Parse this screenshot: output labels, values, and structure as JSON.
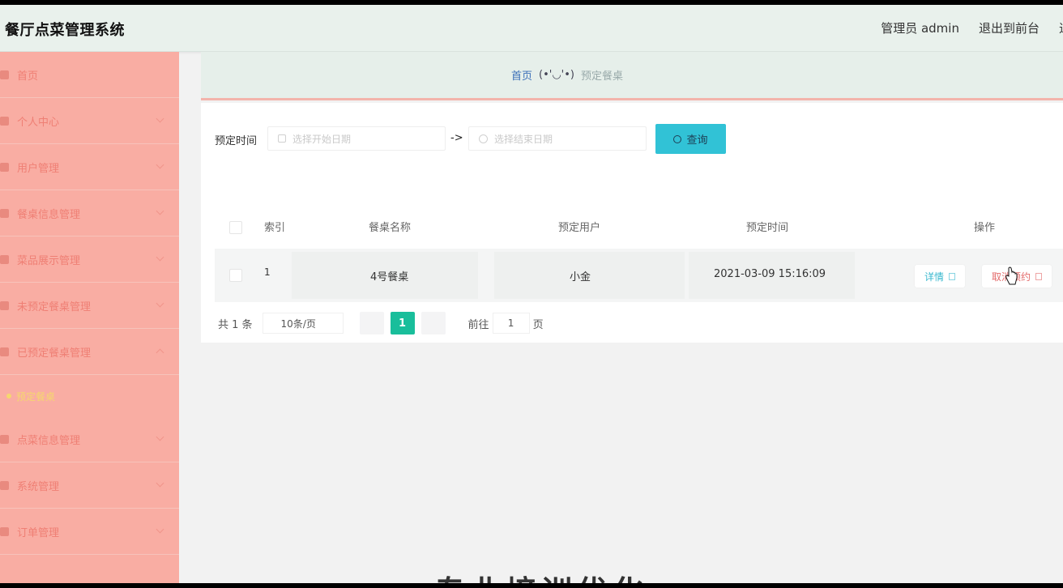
{
  "header": {
    "title": "餐厅点菜管理系统",
    "admin_label": "管理员 admin",
    "exit_front_label": "退出到前台",
    "exit_label": "退"
  },
  "sidebar": {
    "items": [
      {
        "label": "首页",
        "icon": "home-icon"
      },
      {
        "label": "个人中心",
        "icon": "user-icon"
      },
      {
        "label": "用户管理",
        "icon": "users-icon"
      },
      {
        "label": "餐桌信息管理",
        "icon": "table-icon"
      },
      {
        "label": "菜品展示管理",
        "icon": "dish-icon"
      },
      {
        "label": "未预定餐桌管理",
        "icon": "calendar-icon"
      },
      {
        "label": "已预定餐桌管理",
        "icon": "calendar-check-icon"
      },
      {
        "label": "点菜信息管理",
        "icon": "menu-icon"
      },
      {
        "label": "系统管理",
        "icon": "gear-icon"
      },
      {
        "label": "订单管理",
        "icon": "order-icon"
      }
    ],
    "active_sub": "预定餐桌",
    "colors": {
      "background": "#f9ada3",
      "text": "#ef7f74",
      "active": "#f5d76e"
    }
  },
  "breadcrumb": {
    "home": "首页",
    "separator": "(•'◡'•)",
    "current": "预定餐桌"
  },
  "search": {
    "label": "预定时间",
    "start_placeholder": "选择开始日期",
    "arrow": "->",
    "end_placeholder": "选择结束日期",
    "button_label": "查询"
  },
  "table": {
    "columns": [
      "索引",
      "餐桌名称",
      "预定用户",
      "预定时间",
      "操作"
    ],
    "rows": [
      {
        "index": "1",
        "table_name": "4号餐桌",
        "user": "小金",
        "time": "2021-03-09 15:16:09",
        "actions": [
          "详情",
          "取消预约"
        ]
      }
    ]
  },
  "pagination": {
    "total_text": "共 1 条",
    "page_size": "10条/页",
    "current_page": "1",
    "goto_label": "前往",
    "goto_value": "1",
    "page_unit": "页"
  },
  "watermark": "专业培训优化",
  "colors": {
    "accent": "#19be9b",
    "button": "#31c2d6",
    "header_bg": "#e9f1ec",
    "danger": "#e36a6a"
  }
}
